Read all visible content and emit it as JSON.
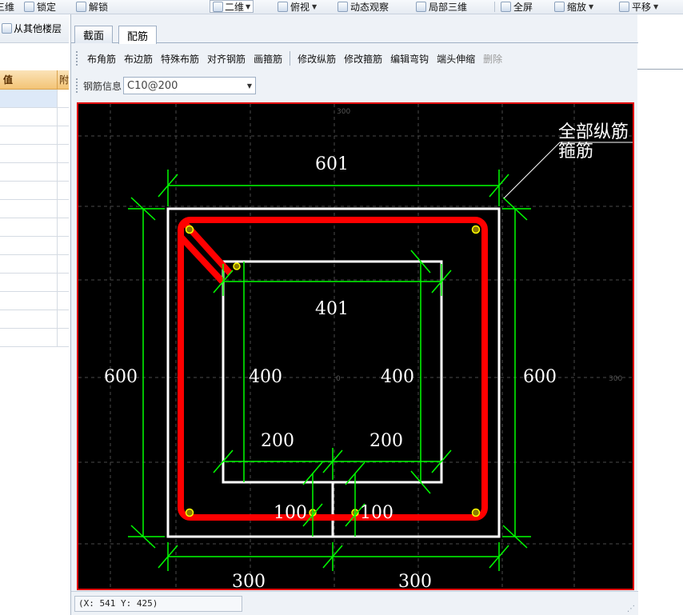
{
  "top_toolbar": {
    "items": [
      {
        "label": "三维",
        "icon": "3d-view-icon"
      },
      {
        "label": "锁定",
        "icon": "lock-icon"
      },
      {
        "label": "解锁",
        "icon": "unlock-icon"
      },
      {
        "label": "二维",
        "icon": "2d-view-icon"
      },
      {
        "label": "俯视",
        "icon": "top-view-icon"
      },
      {
        "label": "动态观察",
        "icon": "orbit-icon"
      },
      {
        "label": "局部三维",
        "icon": "partial-3d-icon"
      },
      {
        "label": "全屏",
        "icon": "fullscreen-icon"
      },
      {
        "label": "缩放",
        "icon": "zoom-icon"
      },
      {
        "label": "平移",
        "icon": "pan-icon"
      }
    ]
  },
  "left_panel": {
    "copy_floor_label": "从其他楼层",
    "header_value": "值",
    "header_extra": "附"
  },
  "dialog": {
    "tabs": [
      {
        "label": "截面",
        "active": false
      },
      {
        "label": "配筋",
        "active": true
      }
    ],
    "toolbar": {
      "buttons": [
        "布角筋",
        "布边筋",
        "特殊布筋",
        "对齐钢筋",
        "画箍筋",
        "修改纵筋",
        "修改箍筋",
        "编辑弯钩",
        "端头伸缩",
        "删除"
      ],
      "disabled": [
        "删除"
      ]
    },
    "rebar_info": {
      "label": "钢筋信息",
      "value": "C10@200"
    },
    "status": {
      "coordinates": "(X: 541 Y: 425)"
    }
  },
  "drawing": {
    "annotation_all_longitudinal": "全部纵筋",
    "annotation_stirrup": "箍筋",
    "dim_top": "601",
    "dim_inner_top": "401",
    "dim_left": "600",
    "dim_right": "600",
    "dim_inner_left": "400",
    "dim_inner_right": "400",
    "dim_mid_left": "200",
    "dim_mid_right": "200",
    "dim_small_left": "100",
    "dim_small_right": "100",
    "dim_bottom_left": "300",
    "dim_bottom_right": "300",
    "axis_origin": "0",
    "axis_right": "300",
    "axis_top": "300",
    "colors": {
      "background": "#000000",
      "outline": "#ffffff",
      "dimension": "#00ff00",
      "stirrup": "#ff0000",
      "rebar": "#ffff00",
      "grid": "#4a4a4a"
    }
  }
}
